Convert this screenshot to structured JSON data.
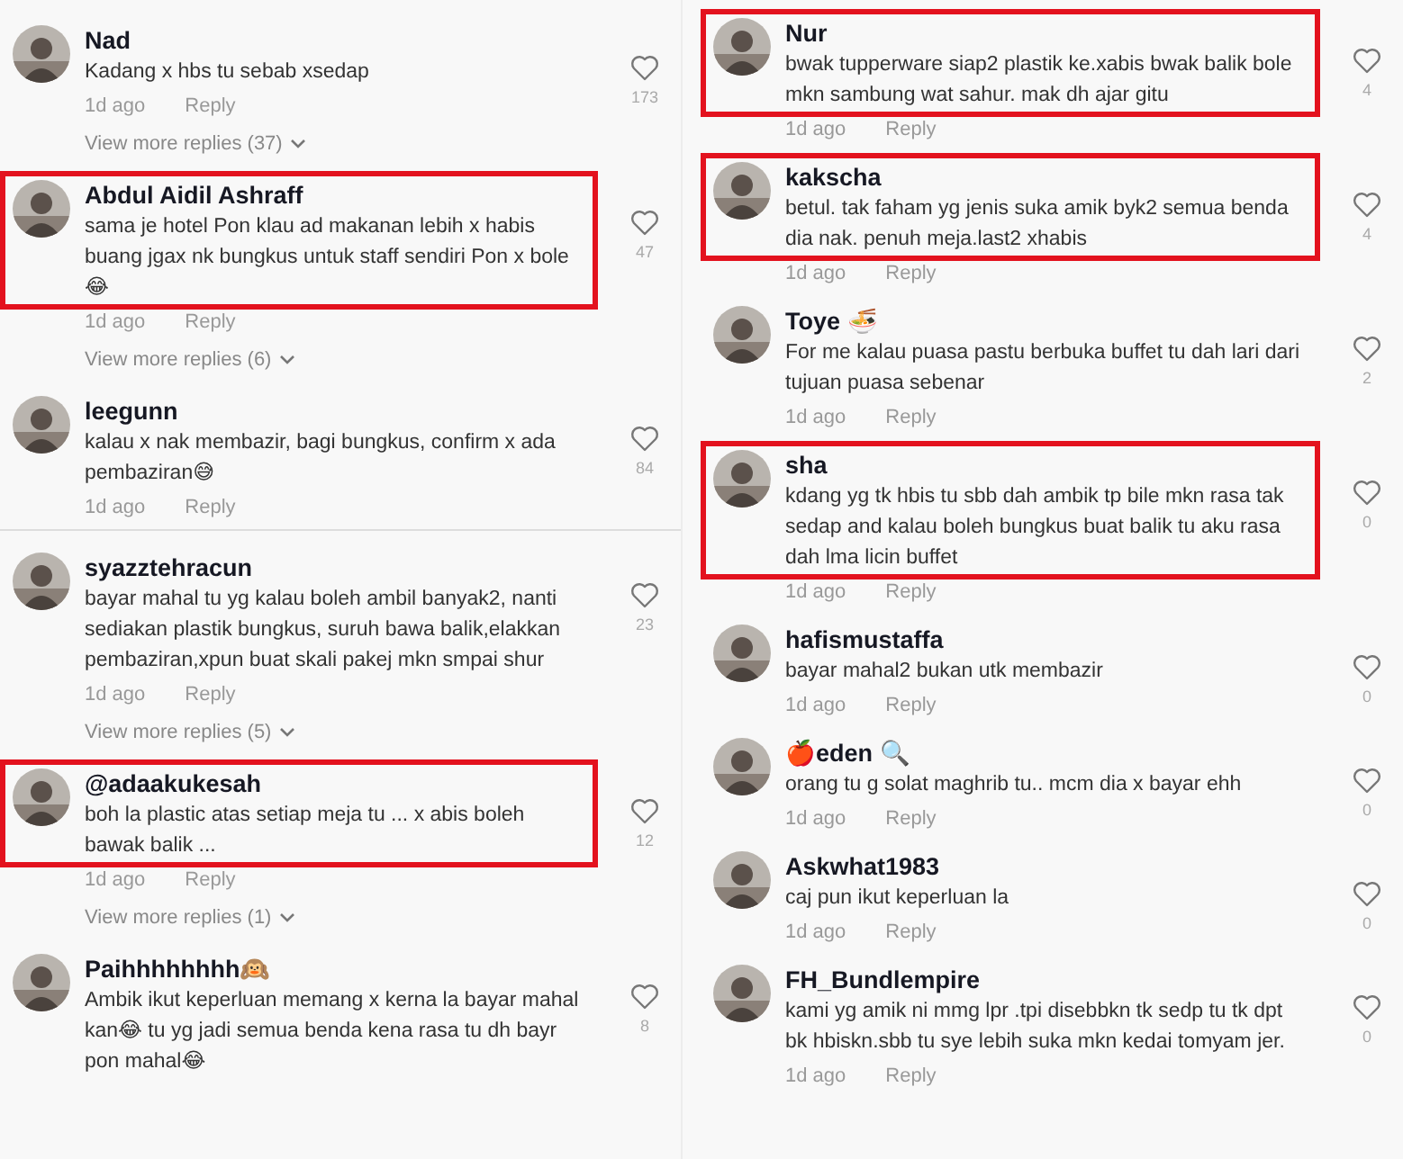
{
  "columns": [
    {
      "items": [
        {
          "kind": "comment",
          "name": "Nad",
          "text": "Kadang x hbs tu sebab xsedap",
          "time": "1d ago",
          "reply": "Reply",
          "likes": "173",
          "highlighted": false
        },
        {
          "kind": "more",
          "label": "View more replies (37)"
        },
        {
          "kind": "comment",
          "name": "Abdul Aidil Ashraff",
          "text": "sama je hotel Pon klau ad makanan lebih x habis buang jgax nk bungkus untuk staff sendiri Pon x bole 😂",
          "time": "1d ago",
          "reply": "Reply",
          "likes": "47",
          "highlighted": true
        },
        {
          "kind": "more",
          "label": "View more replies (6)"
        },
        {
          "kind": "comment",
          "name": "leegunn",
          "text": "kalau x nak membazir, bagi bungkus, confirm x ada pembaziran😅",
          "time": "1d ago",
          "reply": "Reply",
          "likes": "84",
          "highlighted": false
        },
        {
          "kind": "divider"
        },
        {
          "kind": "comment",
          "name": "syazztehracun",
          "text": "bayar mahal tu yg kalau boleh ambil banyak2, nanti sediakan plastik bungkus, suruh bawa balik,elakkan pembaziran,xpun buat skali pakej mkn smpai shur",
          "time": "1d ago",
          "reply": "Reply",
          "likes": "23",
          "highlighted": false
        },
        {
          "kind": "more",
          "label": "View more replies (5)"
        },
        {
          "kind": "comment",
          "name": "@adaakukesah",
          "text": "boh la plastic atas setiap meja tu ... x abis boleh bawak balik ...",
          "time": "1d ago",
          "reply": "Reply",
          "likes": "12",
          "highlighted": true
        },
        {
          "kind": "more",
          "label": "View more replies (1)"
        },
        {
          "kind": "comment",
          "name": "Paihhhhhhhh🙉",
          "text": "Ambik ikut keperluan memang x kerna la bayar mahal kan😂 tu yg jadi semua benda kena rasa tu dh bayr pon mahal😂",
          "likes": "8",
          "highlighted": false
        }
      ]
    },
    {
      "items": [
        {
          "kind": "comment",
          "name": "Nur",
          "text": "bwak tupperware siap2 plastik ke.xabis bwak balik bole mkn sambung wat sahur. mak dh ajar gitu",
          "time": "1d ago",
          "reply": "Reply",
          "likes": "4",
          "highlighted": true
        },
        {
          "kind": "comment",
          "name": "kakscha",
          "text": "betul. tak faham yg jenis suka amik byk2 semua benda dia nak. penuh meja.last2 xhabis",
          "time": "1d ago",
          "reply": "Reply",
          "likes": "4",
          "highlighted": true
        },
        {
          "kind": "comment",
          "name": "Toye 🍜",
          "text": "For me kalau puasa pastu berbuka buffet tu dah lari dari tujuan puasa sebenar",
          "time": "1d ago",
          "reply": "Reply",
          "likes": "2",
          "highlighted": false
        },
        {
          "kind": "comment",
          "name": "sha",
          "text": "kdang yg tk hbis tu sbb dah ambik tp bile mkn rasa tak sedap and kalau boleh bungkus buat balik tu aku rasa dah lma licin buffet",
          "time": "1d ago",
          "reply": "Reply",
          "likes": "0",
          "highlighted": true
        },
        {
          "kind": "comment",
          "name": "hafismustaffa",
          "text": "bayar mahal2 bukan utk membazir",
          "time": "1d ago",
          "reply": "Reply",
          "likes": "0",
          "highlighted": false
        },
        {
          "kind": "comment",
          "name": "🍎eden 🔍",
          "text": "orang tu g solat maghrib tu.. mcm dia x bayar ehh",
          "time": "1d ago",
          "reply": "Reply",
          "likes": "0",
          "highlighted": false
        },
        {
          "kind": "comment",
          "name": "Askwhat1983",
          "text": "caj pun ikut keperluan la",
          "time": "1d ago",
          "reply": "Reply",
          "likes": "0",
          "highlighted": false
        },
        {
          "kind": "comment",
          "name": "FH_Bundlempire",
          "text": "kami yg amik ni mmg lpr .tpi disebbkn tk sedp tu tk dpt bk hbiskn.sbb tu sye lebih suka mkn kedai tomyam jer.",
          "time": "1d ago",
          "reply": "Reply",
          "likes": "0",
          "highlighted": false
        }
      ]
    }
  ]
}
